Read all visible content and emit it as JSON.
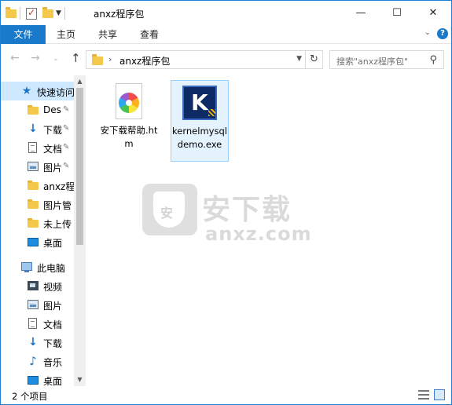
{
  "window": {
    "title": "anxz程序包",
    "minimize_glyph": "—",
    "maximize_glyph": "☐",
    "close_glyph": "✕"
  },
  "ribbon": {
    "tabs": [
      {
        "label": "文件",
        "active": true
      },
      {
        "label": "主页"
      },
      {
        "label": "共享"
      },
      {
        "label": "查看"
      }
    ],
    "expand_glyph": "⌄",
    "help_glyph": "?"
  },
  "address": {
    "back_glyph": "←",
    "forward_glyph": "→",
    "recent_glyph": "⌄",
    "up_glyph": "↑",
    "separator": "›",
    "path": "anxz程序包",
    "refresh_glyph": "↻",
    "search_placeholder": "搜索\"anxz程序包\""
  },
  "sidebar": {
    "quick_access": {
      "label": "快速访问",
      "icon": "star-icon"
    },
    "pinned": [
      {
        "label": "Des",
        "icon": "folder-icon",
        "pinned": true
      },
      {
        "label": "下载",
        "icon": "download-icon",
        "pinned": true
      },
      {
        "label": "文档",
        "icon": "document-icon",
        "pinned": true
      },
      {
        "label": "图片",
        "icon": "picture-icon",
        "pinned": true
      },
      {
        "label": "anxz程",
        "icon": "folder-icon"
      },
      {
        "label": "图片管",
        "icon": "folder-icon"
      },
      {
        "label": "未上传",
        "icon": "folder-icon"
      },
      {
        "label": "桌面",
        "icon": "desktop-icon"
      }
    ],
    "this_pc": {
      "label": "此电脑",
      "icon": "computer-icon"
    },
    "pc_items": [
      {
        "label": "视频",
        "icon": "video-icon"
      },
      {
        "label": "图片",
        "icon": "picture-icon"
      },
      {
        "label": "文档",
        "icon": "document-icon"
      },
      {
        "label": "下载",
        "icon": "download-icon"
      },
      {
        "label": "音乐",
        "icon": "music-icon"
      },
      {
        "label": "桌面",
        "icon": "desktop-icon"
      }
    ],
    "pin_glyph": "📌"
  },
  "files": [
    {
      "name": "安下载帮助.htm",
      "icon": "htm-file-icon",
      "selected": false
    },
    {
      "name": "kernelmysqldemo.exe",
      "icon": "kernel-exe-icon",
      "selected": true
    }
  ],
  "watermark": {
    "shield_text": "安",
    "cn": "安下载",
    "en": "anxz.com"
  },
  "status": {
    "item_count": "2 个项目"
  }
}
